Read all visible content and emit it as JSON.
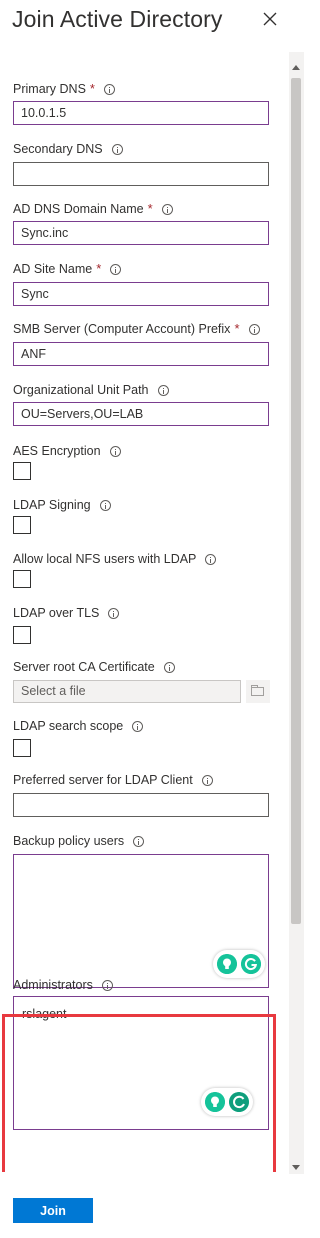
{
  "header": {
    "title": "Join Active Directory"
  },
  "fields": {
    "primary_dns": {
      "label": "Primary DNS",
      "required": "*",
      "value": "10.0.1.5"
    },
    "secondary_dns": {
      "label": "Secondary DNS",
      "value": ""
    },
    "ad_dns_domain": {
      "label": "AD DNS Domain Name",
      "required": "*",
      "value": "Sync.inc"
    },
    "ad_site": {
      "label": "AD Site Name",
      "required": "*",
      "value": "Sync"
    },
    "smb_prefix": {
      "label": "SMB Server (Computer Account) Prefix",
      "required": "*",
      "value": "ANF"
    },
    "ou_path": {
      "label": "Organizational Unit Path",
      "value": "OU=Servers,OU=LAB"
    },
    "aes_encryption": {
      "label": "AES Encryption",
      "checked": false
    },
    "ldap_signing": {
      "label": "LDAP Signing",
      "checked": false
    },
    "allow_local_nfs": {
      "label": "Allow local NFS users with LDAP",
      "checked": false
    },
    "ldap_over_tls": {
      "label": "LDAP over TLS",
      "checked": false
    },
    "server_root_ca": {
      "label": "Server root CA Certificate",
      "placeholder": "Select a file"
    },
    "ldap_search_scope": {
      "label": "LDAP search scope",
      "checked": false
    },
    "preferred_server": {
      "label": "Preferred server for LDAP Client",
      "value": ""
    },
    "backup_policy_users": {
      "label": "Backup policy users",
      "value": ""
    },
    "administrators": {
      "label": "Administrators",
      "value": "rslagent"
    }
  },
  "footer": {
    "join_label": "Join"
  },
  "icons": {
    "info": "info-icon",
    "close": "close-icon",
    "folder": "folder-icon",
    "grammarly_bulb": "lightbulb-icon",
    "grammarly_g": "grammarly-icon"
  },
  "colors": {
    "accent": "#0078d4",
    "required": "#a4262c",
    "focus_border": "#7a3d8f",
    "highlight": "#e8393f",
    "grammarly": "#15c39a"
  }
}
